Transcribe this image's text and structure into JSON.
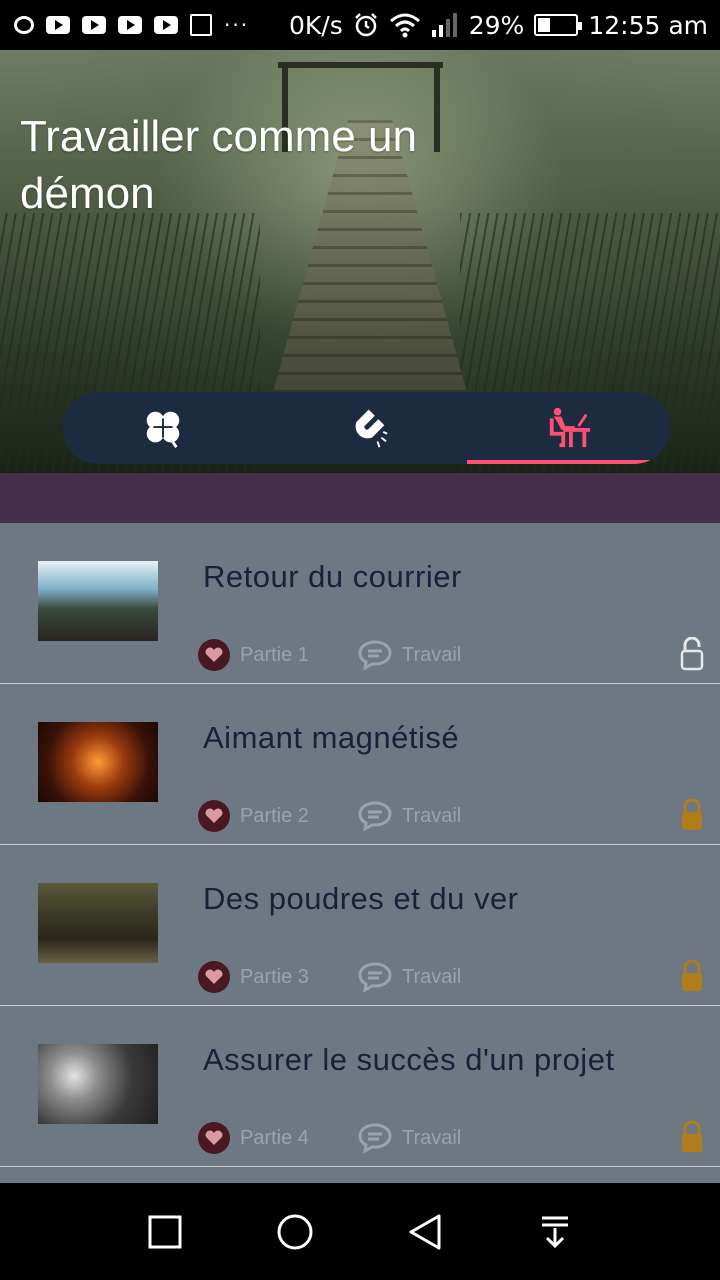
{
  "status_bar": {
    "speed": "0K/s",
    "battery": "29%",
    "time": "12:55 am"
  },
  "header": {
    "title": "Travailler comme un démon"
  },
  "tabs": [
    {
      "icon": "clover-icon",
      "active": false
    },
    {
      "icon": "magnet-icon",
      "active": false
    },
    {
      "icon": "desk-icon",
      "active": true
    }
  ],
  "colors": {
    "accent": "#ff4f72",
    "tab_bg": "#1c2b3f",
    "band": "#44304a",
    "list_bg": "#6e7882",
    "lock_locked": "#b07d1a",
    "lock_unlocked": "#e8e8e8"
  },
  "items": [
    {
      "title": "Retour du courrier",
      "part": "Partie 1",
      "category": "Travail",
      "locked": false
    },
    {
      "title": "Aimant magnétisé",
      "part": "Partie 2",
      "category": "Travail",
      "locked": true
    },
    {
      "title": "Des poudres et du ver",
      "part": "Partie 3",
      "category": "Travail",
      "locked": true
    },
    {
      "title": "Assurer le succès d'un projet",
      "part": "Partie 4",
      "category": "Travail",
      "locked": true
    }
  ]
}
